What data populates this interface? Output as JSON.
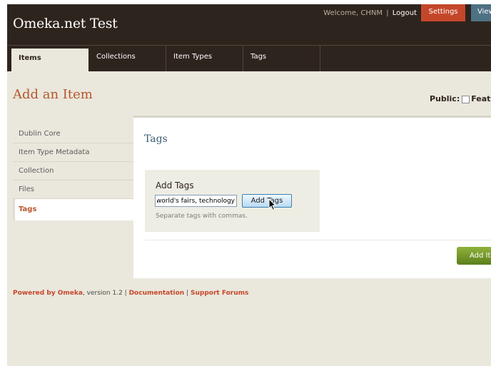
{
  "header": {
    "site_title": "Omeka.net Test",
    "welcome": "Welcome, CHNM",
    "separator": "|",
    "logout": "Logout",
    "settings": "Settings",
    "view": "View"
  },
  "nav": {
    "tabs": [
      {
        "label": "Items",
        "active": true
      },
      {
        "label": "Collections",
        "active": false
      },
      {
        "label": "Item Types",
        "active": false
      },
      {
        "label": "Tags",
        "active": false
      }
    ]
  },
  "page": {
    "title": "Add an Item",
    "public_label": "Public:",
    "featured_label": "Featured:"
  },
  "sidebar": {
    "items": [
      {
        "label": "Dublin Core",
        "active": false
      },
      {
        "label": "Item Type Metadata",
        "active": false
      },
      {
        "label": "Collection",
        "active": false
      },
      {
        "label": "Files",
        "active": false
      },
      {
        "label": "Tags",
        "active": true
      }
    ]
  },
  "panel": {
    "title": "Tags",
    "add_tags_label": "Add Tags",
    "tags_input_value": "world's fairs, technology",
    "add_tags_button": "Add Tags",
    "help_text": "Separate tags with commas.",
    "add_item_button": "Add Item"
  },
  "footer": {
    "powered_by": "Powered by Omeka",
    "version": ", version 1.2 | ",
    "documentation": "Documentation",
    "sep": " | ",
    "support": "Support Forums"
  },
  "colors": {
    "header_bg": "#2e241e",
    "page_bg": "#eae7dd",
    "accent_orange": "#b7562a",
    "settings_red": "#c4472a",
    "view_blue": "#4e7184",
    "button_green": "#6f9227"
  }
}
